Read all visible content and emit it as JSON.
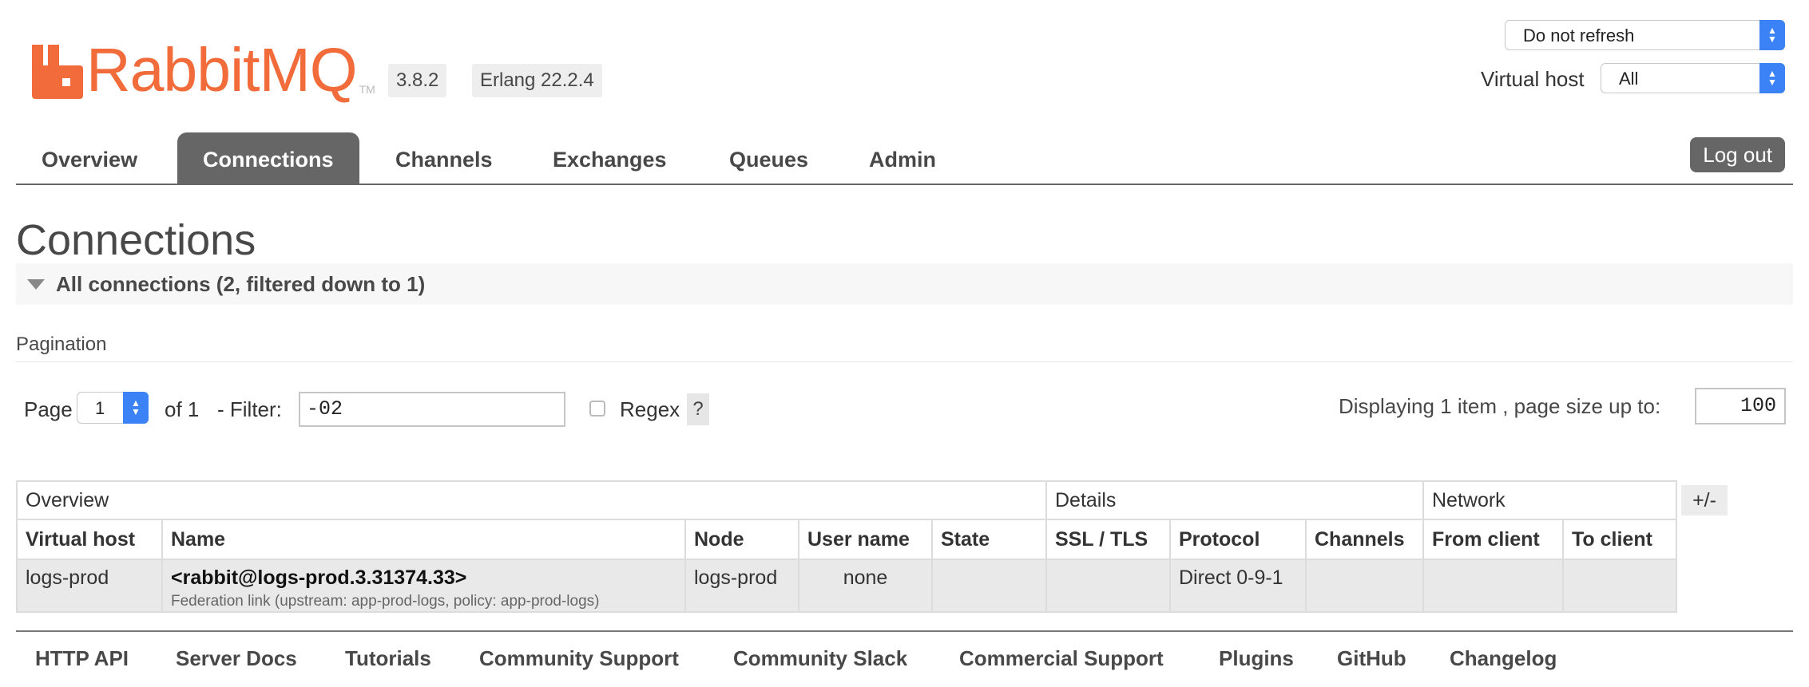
{
  "header": {
    "logo_text": "RabbitMQ",
    "logo_tm": "TM",
    "version": "3.8.2",
    "erlang": "Erlang 22.2.4",
    "refresh_value": "Do not refresh",
    "vhost_label": "Virtual host",
    "vhost_value": "All",
    "brand_color": "#f26b3a"
  },
  "nav": {
    "tabs": [
      "Overview",
      "Connections",
      "Channels",
      "Exchanges",
      "Queues",
      "Admin"
    ],
    "active": "Connections",
    "logout": "Log out"
  },
  "page": {
    "title": "Connections",
    "section": "All connections (2, filtered down to 1)",
    "pagination_heading": "Pagination",
    "page_label": "Page",
    "page_value": "1",
    "of_label": "of 1",
    "filter_label": "- Filter:",
    "filter_value": "-02",
    "regex_label": "Regex",
    "help": "?",
    "displaying": "Displaying 1 item , page size up to:",
    "page_size": "100"
  },
  "table": {
    "groups": [
      "Overview",
      "Details",
      "Network"
    ],
    "columns": [
      "Virtual host",
      "Name",
      "Node",
      "User name",
      "State",
      "SSL / TLS",
      "Protocol",
      "Channels",
      "From client",
      "To client"
    ],
    "rows": [
      {
        "vhost": "logs-prod",
        "name": "<rabbit@logs-prod.3.31374.33>",
        "name_sub": "Federation link (upstream: app-prod-logs, policy: app-prod-logs)",
        "node": "logs-prod",
        "user": "none",
        "state": "",
        "ssl": "",
        "protocol": "Direct 0-9-1",
        "channels": "",
        "from_client": "",
        "to_client": ""
      }
    ],
    "toggle": "+/-"
  },
  "footer": {
    "links": [
      "HTTP API",
      "Server Docs",
      "Tutorials",
      "Community Support",
      "Community Slack",
      "Commercial Support",
      "Plugins",
      "GitHub",
      "Changelog"
    ]
  }
}
